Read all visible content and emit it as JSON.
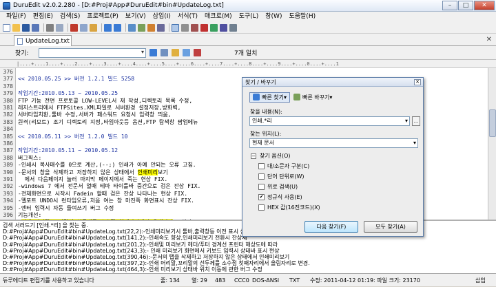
{
  "window": {
    "title": "DuruEdit v2.0.2.280 - [D:#Proj#App#DuruEdit#bin#UpdateLog.txt]"
  },
  "menu": [
    "파일(F)",
    "편집(E)",
    "검색(S)",
    "프로젝트(P)",
    "보기(V)",
    "삽입(I)",
    "서식(T)",
    "매크로(M)",
    "도구(L)",
    "창(W)",
    "도움말(H)"
  ],
  "tabs": [
    {
      "label": "UpdateLog.txt"
    }
  ],
  "findbar": {
    "label": "찾기:",
    "value": "",
    "status": "7개 일치"
  },
  "ruler": "|....+....1....+....2....+....3....+....4....+....5....+....6....+....7....+....8....+....9....+....0....+....1",
  "editor": {
    "lines": [
      {
        "num": "376",
        "text": ""
      },
      {
        "num": "377",
        "text": "<< 2010.05.25 >> 버전 1.2.1 빌드 5258",
        "kind": "hdr"
      },
      {
        "num": "378",
        "text": ""
      },
      {
        "num": "379",
        "text": "작업기간:2010.05.13 ~ 2010.05.25",
        "kind": "hdr"
      },
      {
        "num": "380",
        "text": "FTP 기능 전면 프로토콜 LOW-LEVEL서 재 작성,디렉토리 목록 수정,"
      },
      {
        "num": "381",
        "text": "레지스트리에서 FTPSites.XML파일로 서버환경 설정저장,방화벽,"
      },
      {
        "num": "382",
        "text": "서버타임치환,툴바 수정,서버가 패스워드 요청시 입력창 띄움,"
      },
      {
        "num": "383",
        "text": "원격(리모트) 조기 디렉토리 지정,타임아웃등 옵션,FTP 탐색창 팝업메뉴"
      },
      {
        "num": "384",
        "text": ""
      },
      {
        "num": "385",
        "text": "<< 2010.05.11 >> 버전 1.2.0 빌드 10",
        "kind": "hdr"
      },
      {
        "num": "386",
        "text": ""
      },
      {
        "num": "387",
        "text": "작업기간:2010.05.11 ~ 2010.05.12",
        "kind": "hdr"
      },
      {
        "num": "388",
        "text": "버그픽스:"
      },
      {
        "num": "389",
        "text": "-인쇄시 복사매수를 0으로 계산,(--;) 인쇄가 아예 안되는 오류 고침."
      },
      {
        "num": "390",
        "text": "-문서의 창을 삭제하고 저장하지 않은 상태에서 ",
        "hl": "인쇄미리",
        "after": "보기"
      },
      {
        "num": "391",
        "text": "  에서 다음페이지 눌러 마지막 페이지에서 죽는 현상 FIX."
      },
      {
        "num": "392",
        "text": "-windows 7 에서 전문서 열때 테마 타이틀바 중간으로 검은 잔상 FIX."
      },
      {
        "num": "393",
        "text": "-전체화면으로 시작시 Fadein 할때 검은 잔상 나타나는 현상 FIX."
      },
      {
        "num": "394",
        "text": "-멜포트 UNDO시 런타임오류,처음 여는 창 마진쪽 화면표시 잔상 FIX."
      },
      {
        "num": "395",
        "text": "-엔터 입력시 자동 들여쓰기 버그 수정"
      },
      {
        "num": "396",
        "text": "기능개선:"
      },
      {
        "num": "397",
        "text": "-",
        "hl": "인쇄 머리말,꼬리말의 선두개를 소수점 첫째자리에서 올재자리",
        "after": "로 변경."
      },
      {
        "num": "398",
        "text": "  기존의 기본값 0.4mm이 인쇄해본 결과 두꺼워서 0.14mm 로 함."
      },
      {
        "num": "399",
        "text": "-인쇄 미리보기 화면에서 CTRL + 마우스휠로 확대/축소 기능 추가"
      }
    ]
  },
  "output": {
    "lines": [
      "검색 서러드기 [인쇄.*리] 을 찾는 중.",
      "D:#Proj#App#DuruEdit#bin#UpdateLog.txt(22,2):-인쇄미리보기시 툴바,출력창등 이전 표시 상",
      "D:#Proj#App#DuruEdit#bin#UpdateLog.txt(141,2):-인쇄속도 향상,인쇄미리보기 전환시 잔상제",
      "D:#Proj#App#DuruEdit#bin#UpdateLog.txt(201,2):-인쇄및 미리보기 헤더/푸터 경계선 프린터 해상도에 따라",
      "D:#Proj#App#DuruEdit#bin#UpdateLog.txt(243,3):- 인쇄 미리보기 화면에서 키보드 입력시 상태바 표시 현상",
      "D:#Proj#App#DuruEdit#bin#UpdateLog.txt(390,46):-문서의 탭을 삭제하고 저장하지 않은 상태에서 인쇄미리보기",
      "D:#Proj#App#DuruEdit#bin#UpdateLog.txt(397,2):-인쇄 머리말,꼬리말의 선두께를 소수점 첫째자리에서 올림자리로 변경.",
      "D:#Proj#App#DuruEdit#bin#UpdateLog.txt(464,3):-인쇄 미리보기 상태바 위치 이동에 관한 버그 수정"
    ]
  },
  "statusbar": {
    "hint": "듀루에디트 편집기를 사용하고 있습니다",
    "line": "줄: 134",
    "col": "열: 29",
    "total": "483",
    "char": "CCC0",
    "encoding": "DOS-ANSI",
    "type": "TXT",
    "mode": "수정: 2011-04-12 01:19: 파일 크기: 23170",
    "ins": "삽입"
  },
  "dialog": {
    "title": "찾기 / 바꾸기",
    "mode_find": "빠른 찾기",
    "mode_replace": "빠른 바꾸기",
    "find_label": "찾을 내용(N):",
    "find_value": "인쇄.*리",
    "browse_label": "...",
    "where_label": "찾는 위치(L):",
    "where_value": "현재 문서",
    "options_label": "찾기 옵션(O)",
    "options": [
      {
        "label": "대/소문자 구분(C)",
        "checked": false
      },
      {
        "label": "단어 단위로(W)",
        "checked": false
      },
      {
        "label": "위로 검색(U)",
        "checked": false
      },
      {
        "label": "정규식 사용(E)",
        "checked": true
      },
      {
        "label": "HEX 값(16진코드)(X)",
        "checked": false
      }
    ],
    "find_next": "다음 찾기(F)",
    "find_all": "모두 찾기(A)"
  },
  "colors": {
    "highlight": "#ffff00",
    "header_text": "#1a30a0",
    "accent": "#3a7bd5"
  }
}
